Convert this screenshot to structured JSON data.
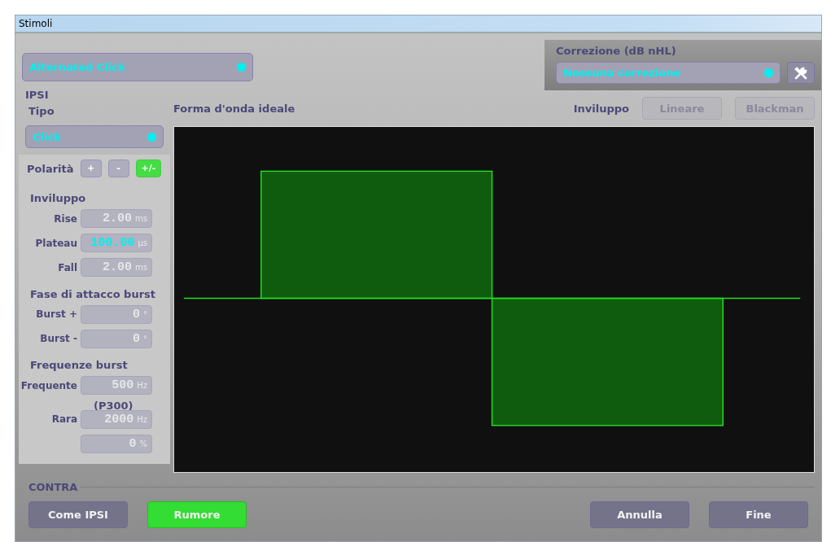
{
  "window": {
    "title": "Stimoli"
  },
  "stimulus": {
    "value": "Alternated Click"
  },
  "correction": {
    "label": "Correzione (dB nHL)",
    "value": "Nessuna correzione"
  },
  "ipsi": {
    "title": "IPSI",
    "type_label": "Tipo",
    "type_value": "Click",
    "polarity": {
      "label": "Polarità",
      "options": [
        {
          "label": "+",
          "selected": false
        },
        {
          "label": "-",
          "selected": false
        },
        {
          "label": "+/-",
          "selected": true
        }
      ]
    },
    "sections": [
      {
        "title": "Inviluppo",
        "fields": [
          {
            "label": "Rise",
            "value": "2.00",
            "unit": "ms",
            "active": false
          },
          {
            "label": "Plateau",
            "value": "100.00",
            "unit": "µs",
            "active": true
          },
          {
            "label": "Fall",
            "value": "2.00",
            "unit": "ms",
            "active": false
          }
        ]
      },
      {
        "title": "Fase di attacco burst",
        "fields": [
          {
            "label": "Burst +",
            "value": "0",
            "unit": "°",
            "active": false
          },
          {
            "label": "Burst -",
            "value": "0",
            "unit": "°",
            "active": false
          }
        ]
      },
      {
        "title": "Frequenze burst",
        "fields": [
          {
            "label": "Frequente",
            "value": "500",
            "unit": "Hz",
            "active": false
          },
          {
            "note": "(P300)",
            "label": "Rara",
            "value": "2000",
            "unit": "Hz",
            "active": false
          },
          {
            "value": "0",
            "unit": "%",
            "active": false
          }
        ]
      }
    ]
  },
  "waveform": {
    "title": "Forma d'onda ideale",
    "envelope_label": "Inviluppo",
    "envelope_options": [
      {
        "label": "Lineare",
        "disabled": true
      },
      {
        "label": "Blackman",
        "disabled": true
      }
    ]
  },
  "contra": {
    "title": "CONTRA",
    "buttons": [
      {
        "label": "Come IPSI",
        "selected": false
      },
      {
        "label": "Rumore",
        "selected": true
      }
    ]
  },
  "footer_buttons": [
    "Annulla",
    "Fine"
  ]
}
